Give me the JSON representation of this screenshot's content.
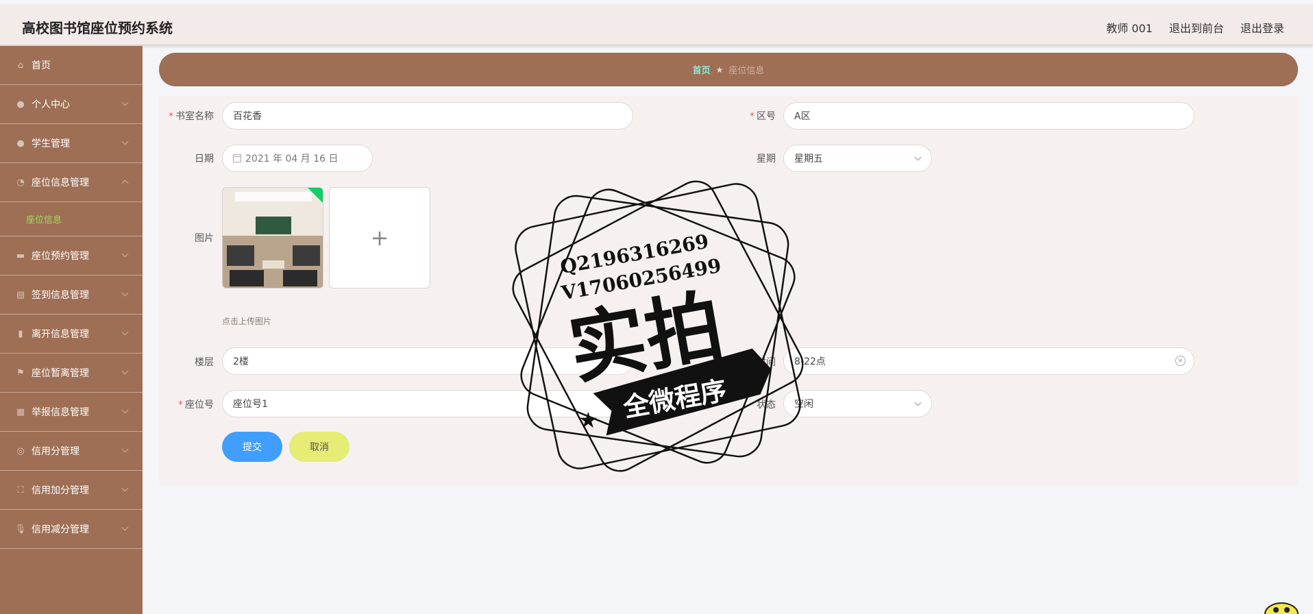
{
  "app": {
    "title": "高校图书馆座位预约系统"
  },
  "header": {
    "user": "教师 001",
    "to_front": "退出到前台",
    "logout": "退出登录"
  },
  "sidebar": {
    "items": [
      {
        "label": "首页",
        "icon": "home-icon"
      },
      {
        "label": "个人中心",
        "icon": "user-icon"
      },
      {
        "label": "学生管理",
        "icon": "student-icon"
      },
      {
        "label": "座位信息管理",
        "icon": "seat-icon",
        "expanded": true,
        "sub": [
          "座位信息"
        ]
      },
      {
        "label": "座位预约管理",
        "icon": "ticket-icon"
      },
      {
        "label": "签到信息管理",
        "icon": "printer-icon"
      },
      {
        "label": "离开信息管理",
        "icon": "bar-chart-icon"
      },
      {
        "label": "座位暂离管理",
        "icon": "flag-icon"
      },
      {
        "label": "举报信息管理",
        "icon": "grid-icon"
      },
      {
        "label": "信用分管理",
        "icon": "compass-icon"
      },
      {
        "label": "信用加分管理",
        "icon": "fullscreen-icon"
      },
      {
        "label": "信用减分管理",
        "icon": "microphone-icon"
      }
    ]
  },
  "breadcrumb": {
    "home": "首页",
    "current": "座位信息"
  },
  "form": {
    "room_name": {
      "label": "书室名称",
      "value": "百花香"
    },
    "area": {
      "label": "区号",
      "value": "A区"
    },
    "date": {
      "label": "日期",
      "value": "2021 年 04 月 16 日"
    },
    "weekday": {
      "label": "星期",
      "value": "星期五"
    },
    "image": {
      "label": "图片",
      "hint": "点击上传图片"
    },
    "floor": {
      "label": "楼层",
      "value": "2楼"
    },
    "open_time": {
      "label": "开放时间",
      "value": "8-22点"
    },
    "seat_no": {
      "label": "座位号",
      "value": "座位号1"
    },
    "status": {
      "label": "状态",
      "value": "空闲"
    },
    "submit": "提交",
    "cancel": "取消"
  },
  "watermark": {
    "line1": "Q2196316269",
    "line2": "V17060256499",
    "big": "实拍",
    "banner": "全微程序"
  },
  "colors": {
    "brand": "#9e6f55",
    "submit": "#409eff",
    "cancel": "#e6ec74",
    "active": "#9be05a"
  }
}
